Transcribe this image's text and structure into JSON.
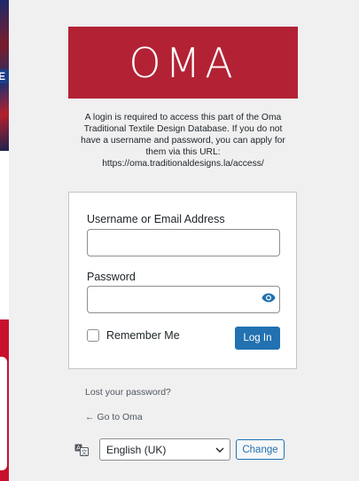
{
  "logo": {
    "text": "OMA",
    "bg_color": "#b22234"
  },
  "background": {
    "tag_text": "E"
  },
  "message": {
    "line1": "A login is required to access this part of the Oma",
    "line2": "Traditional Textile Design Database. If you do not",
    "line3": "have a username and password, you can apply for",
    "line4": "them via this URL:",
    "line5": "https://oma.traditionaldesigns.la/access/"
  },
  "form": {
    "username_label": "Username or Email Address",
    "username_value": "",
    "password_label": "Password",
    "password_value": "",
    "remember_label": "Remember Me",
    "login_label": "Log In",
    "accent_color": "#2271b1"
  },
  "links": {
    "lost_password": "Lost your password?",
    "back_to_site": "← Go to Oma"
  },
  "language": {
    "icon": "translate-icon",
    "selected": "English (UK)",
    "change_label": "Change"
  }
}
